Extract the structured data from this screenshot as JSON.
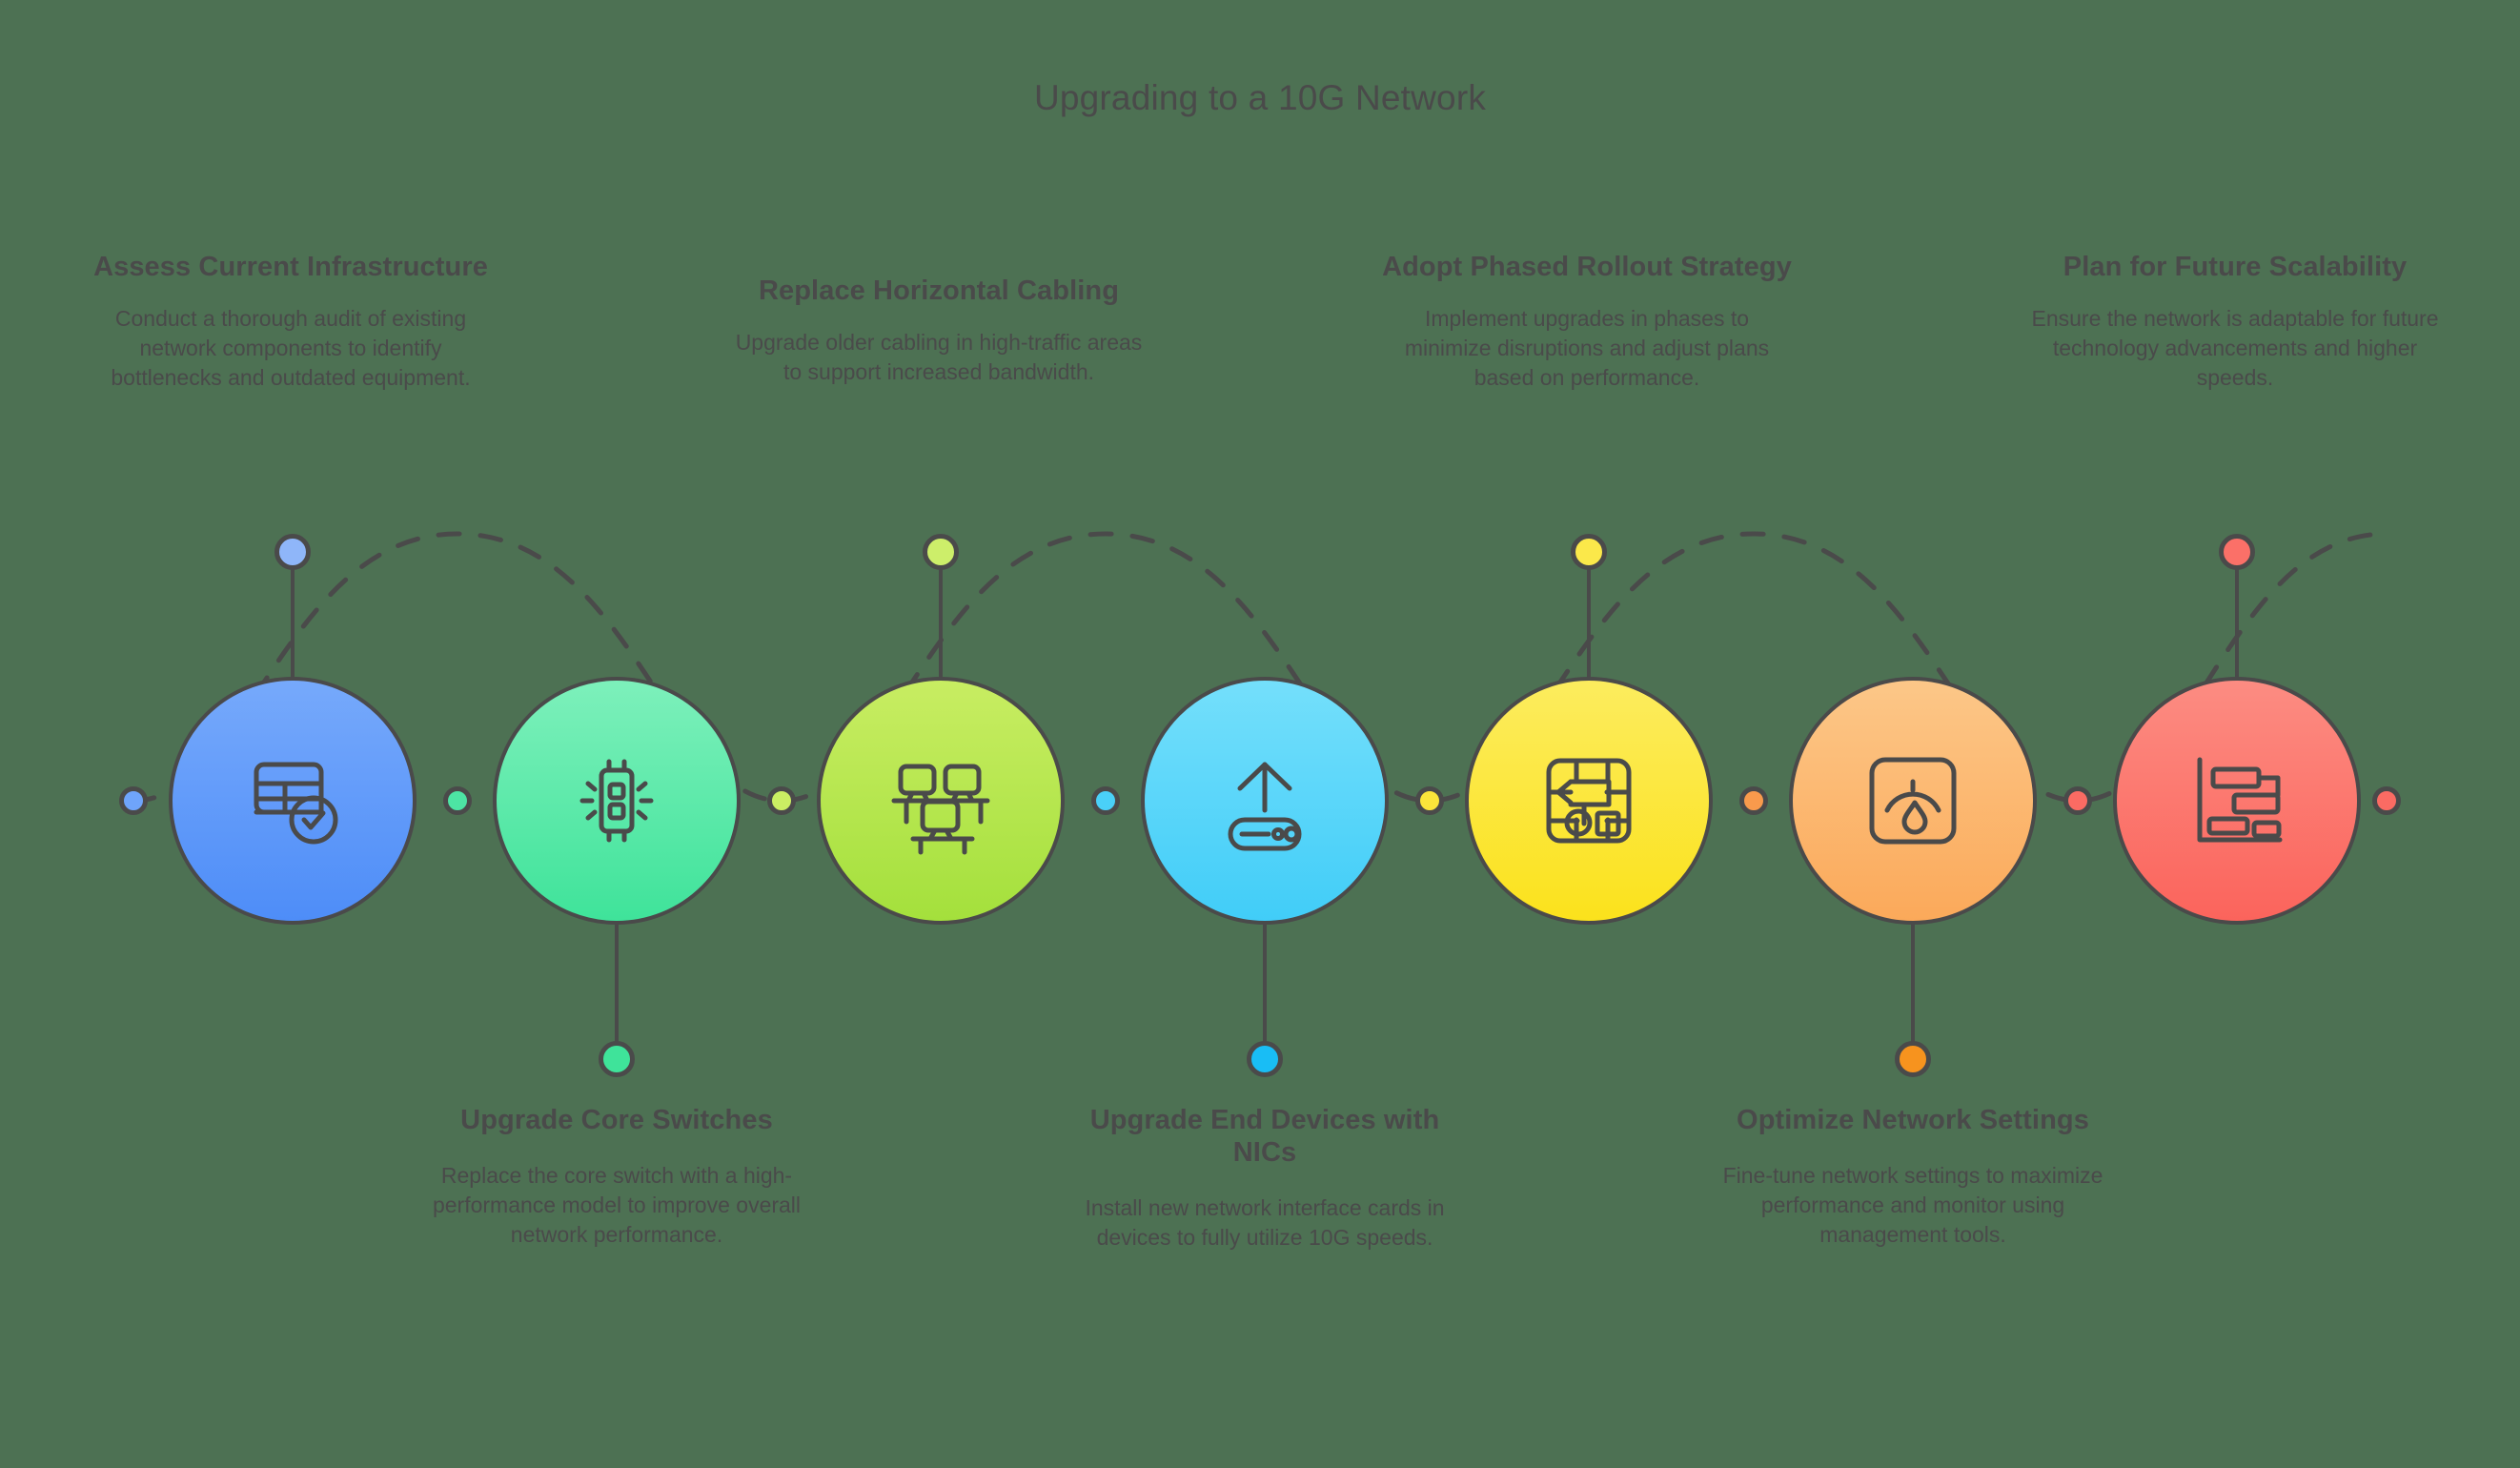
{
  "title": "Upgrading to a 10G Network",
  "background_color": "#4d7153",
  "outline_color": "#4a4a4a",
  "text_color": "#4a4a4a",
  "steps": [
    {
      "index": 1,
      "heading": "Assess Current Infrastructure",
      "description": "Conduct a thorough audit of existing network components to identify bottlenecks and outdated equipment.",
      "icon": "table-check-icon",
      "position": "top",
      "color_top": "#76a9fb",
      "color_bottom": "#4e8df8",
      "dot_color": "#8fb6f9"
    },
    {
      "index": 2,
      "heading": "Upgrade Core Switches",
      "description": "Replace the core switch with a high-performance model to improve overall network performance.",
      "icon": "processor-chip-icon",
      "position": "bottom",
      "color_top": "#7df0bb",
      "color_bottom": "#3fe39a",
      "dot_color": "#3fe39a"
    },
    {
      "index": 3,
      "heading": "Replace Horizontal Cabling",
      "description": "Upgrade older cabling in high-traffic areas to support increased bandwidth.",
      "icon": "workstations-icon",
      "position": "top",
      "color_top": "#c8ed62",
      "color_bottom": "#a4e03c",
      "dot_color": "#cdee6a"
    },
    {
      "index": 4,
      "heading": "Upgrade End Devices with NICs",
      "description": "Install new network interface cards in devices to fully utilize 10G speeds.",
      "icon": "upload-device-icon",
      "position": "bottom",
      "color_top": "#74dffb",
      "color_bottom": "#41cdf8",
      "dot_color": "#19bdf5"
    },
    {
      "index": 5,
      "heading": "Adopt Phased Rollout Strategy",
      "description": "Implement upgrades in phases to minimize disruptions and adjust plans based on performance.",
      "icon": "circuit-board-icon",
      "position": "top",
      "color_top": "#fcec5e",
      "color_bottom": "#fbe21c",
      "dot_color": "#fbe84a"
    },
    {
      "index": 6,
      "heading": "Optimize Network Settings",
      "description": "Fine-tune network settings to maximize performance and monitor using management tools.",
      "icon": "gauge-meter-icon",
      "position": "bottom",
      "color_top": "#fcc788",
      "color_bottom": "#fba95a",
      "dot_color": "#f7931e"
    },
    {
      "index": 7,
      "heading": "Plan for Future Scalability",
      "description": "Ensure the network is adaptable for future technology advancements and higher speeds.",
      "icon": "gantt-chart-icon",
      "position": "top",
      "color_top": "#fc8c82",
      "color_bottom": "#fb645c",
      "dot_color": "#fb7068"
    }
  ],
  "wave_dots": [
    {
      "name": "wave-dot-start",
      "color": "#6fa4fb"
    },
    {
      "name": "wave-dot-1-2",
      "color": "#4de4a4"
    },
    {
      "name": "wave-dot-2-3",
      "color": "#cbee63"
    },
    {
      "name": "wave-dot-3-4",
      "color": "#4ad0f8"
    },
    {
      "name": "wave-dot-4-5",
      "color": "#fbe53a"
    },
    {
      "name": "wave-dot-5-6",
      "color": "#f99a4c"
    },
    {
      "name": "wave-dot-6-7",
      "color": "#fb6b63"
    },
    {
      "name": "wave-dot-end",
      "color": "#fb6b63"
    }
  ]
}
